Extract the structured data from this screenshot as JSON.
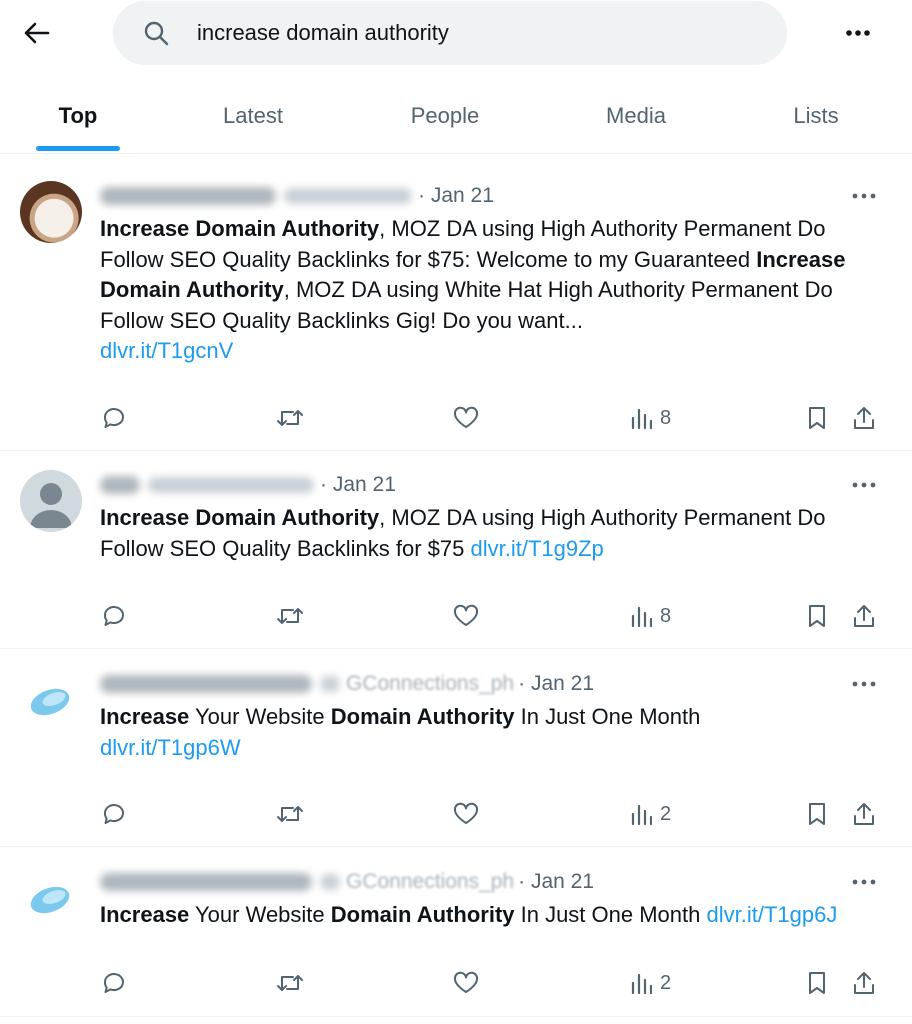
{
  "search": {
    "query": "increase domain authority"
  },
  "tabs": [
    {
      "label": "Top",
      "active": true
    },
    {
      "label": "Latest",
      "active": false
    },
    {
      "label": "People",
      "active": false
    },
    {
      "label": "Media",
      "active": false
    },
    {
      "label": "Lists",
      "active": false
    }
  ],
  "icons": {
    "back": "arrow-left-icon",
    "search": "search-icon",
    "more": "more-horizontal-icon",
    "reply": "reply-icon",
    "retweet": "retweet-icon",
    "like": "heart-icon",
    "views": "views-chart-icon",
    "bookmark": "bookmark-icon",
    "share": "share-icon"
  },
  "colors": {
    "accent": "#1d9bf0",
    "text": "#0f1419",
    "muted": "#536471",
    "search_bg": "#eff3f4"
  },
  "tweets": [
    {
      "handle_tail": "",
      "date": "Jan 21",
      "text": {
        "b1": "Increase Domain Authority",
        "t1": ", MOZ DA using High Authority Permanent Do Follow SEO Quality Backlinks for $75: Welcome to my Guaranteed ",
        "b2": "Increase Domain Authority",
        "t2": ", MOZ DA using White Hat High Authority Permanent Do Follow SEO Quality Backlinks Gig! Do you want...",
        "link": "dlvr.it/T1gcnV"
      },
      "views": "8"
    },
    {
      "handle_tail": "",
      "date": "Jan 21",
      "text": {
        "b1": "Increase Domain Authority",
        "t1": ", MOZ DA using High Authority Permanent Do Follow SEO Quality Backlinks for $75 ",
        "link": "dlvr.it/T1g9Zp"
      },
      "views": "8"
    },
    {
      "handle_tail": "GConnections_ph",
      "date": "Jan 21",
      "text": {
        "b1": "Increase",
        "t1": " Your Website ",
        "b2": "Domain Authority",
        "t2": " In Just One Month",
        "link": "dlvr.it/T1gp6W"
      },
      "views": "2"
    },
    {
      "handle_tail": "GConnections_ph",
      "date": "Jan 21",
      "text": {
        "b1": "Increase",
        "t1": " Your Website ",
        "b2": "Domain Authority",
        "t2": " In Just One Month ",
        "link": "dlvr.it/T1gp6J"
      },
      "views": "2"
    }
  ]
}
